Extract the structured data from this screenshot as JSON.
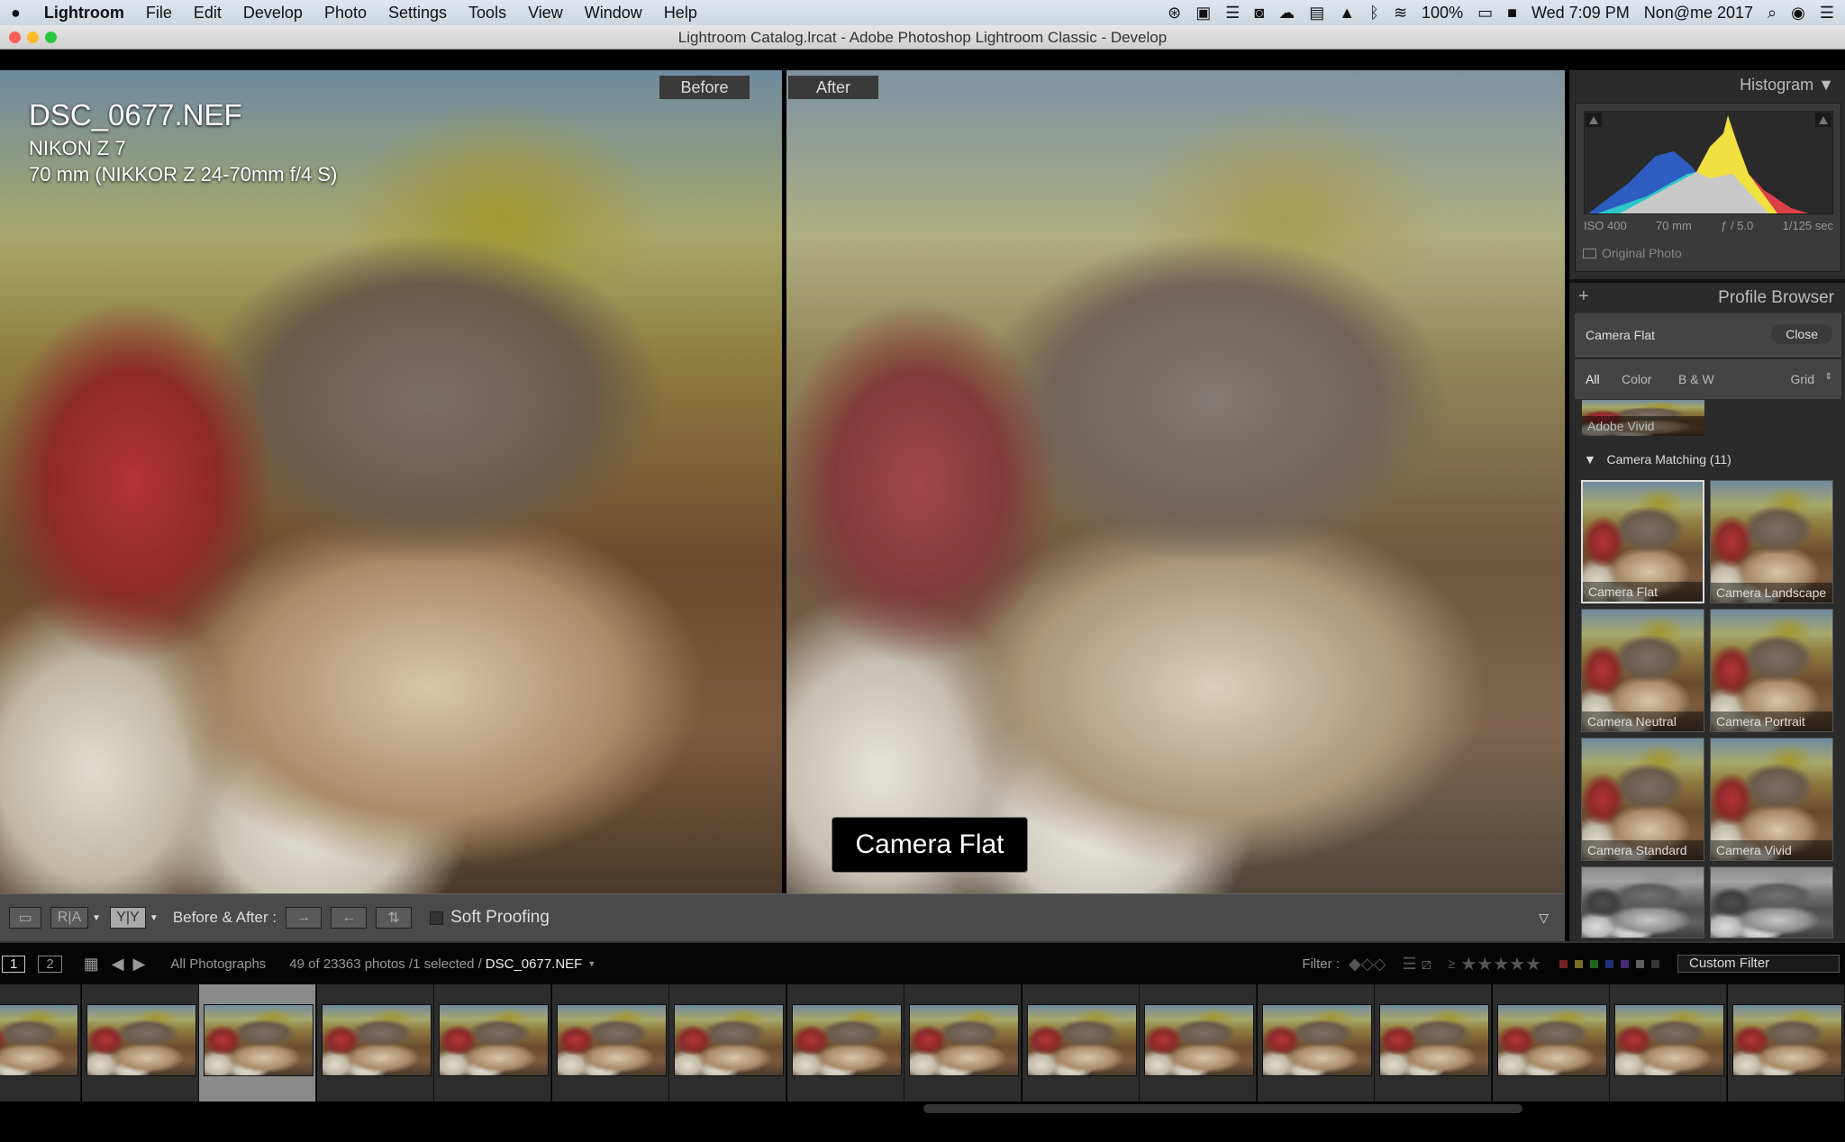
{
  "menubar": {
    "app": "Lightroom",
    "items": [
      "File",
      "Edit",
      "Develop",
      "Photo",
      "Settings",
      "Tools",
      "View",
      "Window",
      "Help"
    ],
    "battery": "100%",
    "clock": "Wed 7:09 PM",
    "user": "Non@me 2017"
  },
  "window_title": "Lightroom Catalog.lrcat - Adobe Photoshop Lightroom Classic - Develop",
  "before_label": "Before",
  "after_label": "After",
  "photo_info": {
    "filename": "DSC_0677.NEF",
    "camera": "NIKON Z 7",
    "lens": "70 mm (NIKKOR Z 24-70mm f/4 S)"
  },
  "overlay_profile": "Camera Flat",
  "toolbar": {
    "view_loupe": "▭",
    "view_ra": "R|A",
    "view_yy": "Y|Y",
    "before_after_label": "Before & After :",
    "soft_proofing": "Soft Proofing",
    "soft_proofing_checked": false
  },
  "histogram": {
    "title": "Histogram",
    "iso": "ISO 400",
    "focal": "70 mm",
    "aperture": "ƒ / 5.0",
    "shutter": "1/125 sec",
    "original_photo": "Original Photo"
  },
  "profile_browser": {
    "title": "Profile Browser",
    "current": "Camera Flat",
    "close": "Close",
    "tabs": [
      "All",
      "Color",
      "B & W"
    ],
    "view": "Grid",
    "prev_item": "Adobe Vivid",
    "group": "Camera Matching (11)",
    "profiles": [
      "Camera Flat",
      "Camera Landscape",
      "Camera Neutral",
      "Camera Portrait",
      "Camera Standard",
      "Camera Vivid",
      "",
      ""
    ],
    "selected": "Camera Flat"
  },
  "filmstrip": {
    "source": "All Photographs",
    "count": "49 of 23363 photos /1 selected /",
    "filename": "DSC_0677.NEF",
    "filter_label": "Filter :",
    "filter_preset": "Custom Filter",
    "monitor1": "1",
    "monitor2": "2",
    "rating_op": "≥",
    "label_colors": [
      "#c83232",
      "#c8b432",
      "#32a032",
      "#3250c8",
      "#7a40c0",
      "#999999",
      "#555555"
    ],
    "selected_index": 2
  }
}
